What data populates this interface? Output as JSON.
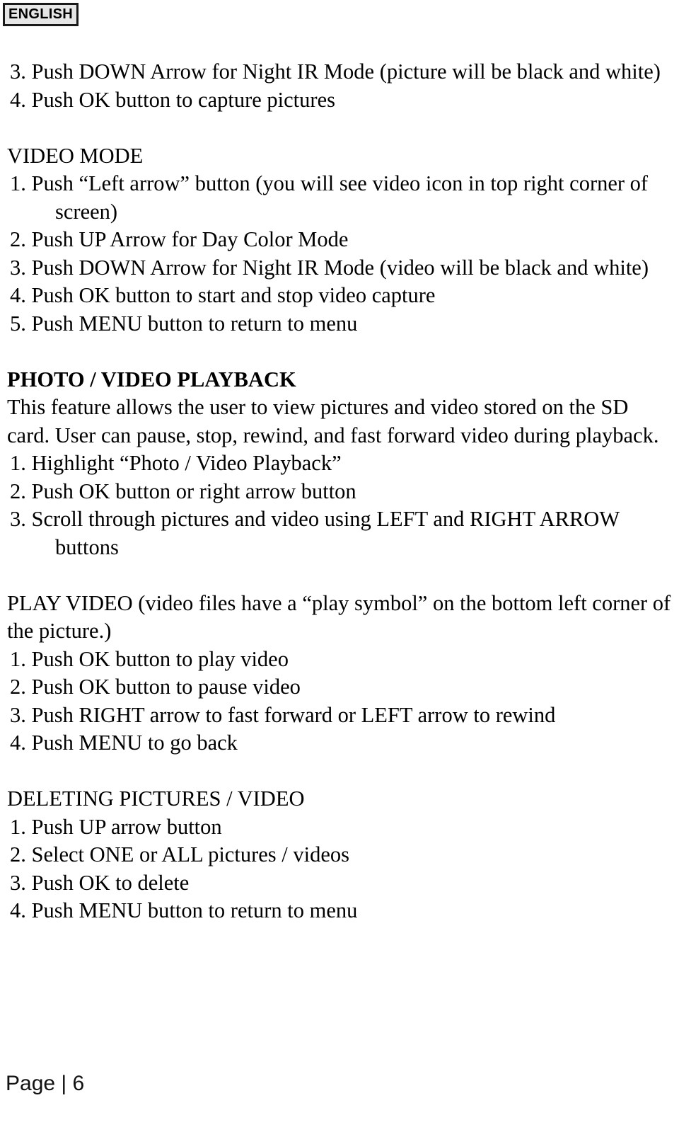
{
  "header": {
    "language_badge": "ENGLISH"
  },
  "footer": {
    "page_label": "Page",
    "separator": "|",
    "page_number": "6",
    "full": "Page | 6"
  },
  "content": {
    "photo_mode_tail_steps": [
      "3. Push DOWN Arrow for Night IR Mode (picture will be black and white)",
      "4. Push OK button to capture pictures"
    ],
    "video_mode": {
      "heading": "VIDEO MODE",
      "steps": [
        "1. Push “Left arrow” button (you will see video icon in top right corner of screen)",
        "2. Push UP Arrow for Day Color Mode",
        "3. Push DOWN Arrow for Night IR Mode (video will be black and white)",
        "4. Push OK button to start and stop video capture",
        "5. Push MENU button to return to menu"
      ]
    },
    "photo_video_playback": {
      "heading": "PHOTO / VIDEO PLAYBACK",
      "description": "This feature allows the user to view pictures and video stored on the SD card. User can pause, stop, rewind, and fast forward video during playback.",
      "steps": [
        "1. Highlight “Photo / Video Playback”",
        "2. Push OK button or right arrow button",
        "3. Scroll through pictures and video using LEFT and RIGHT ARROW buttons"
      ]
    },
    "play_video": {
      "heading": "PLAY VIDEO (video files have a “play symbol” on the bottom left corner of the picture.)",
      "steps": [
        "1. Push OK button to play video",
        "2. Push OK button to pause video",
        "3. Push RIGHT arrow to fast forward or LEFT arrow to rewind",
        "4. Push MENU to go back"
      ]
    },
    "deleting": {
      "heading": "DELETING PICTURES / VIDEO",
      "steps": [
        "1. Push UP arrow button",
        "2. Select ONE or ALL pictures / videos",
        "3. Push OK to delete",
        "4. Push MENU button to return to menu"
      ]
    }
  }
}
